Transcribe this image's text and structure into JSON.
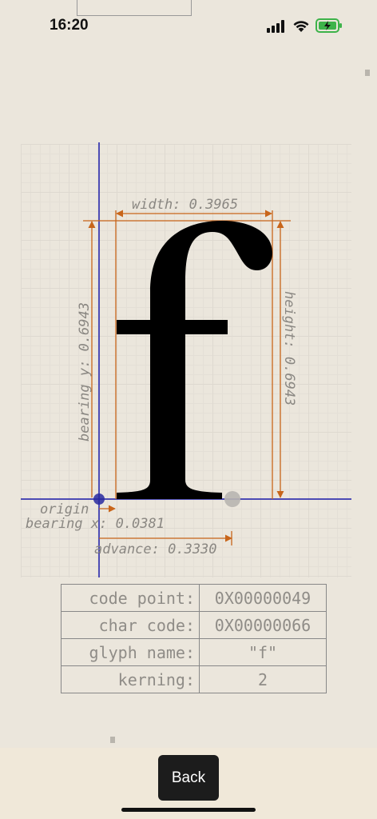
{
  "status_bar": {
    "time": "16:20"
  },
  "glyph": {
    "character": "f",
    "labels": {
      "width": "width: 0.3965",
      "height": "height: 0.6943",
      "bearing_y": "bearing y: 0.6943",
      "origin": "origin",
      "bearing_x": "bearing x: 0.0381",
      "advance": "advance: 0.3330"
    }
  },
  "info_table": [
    {
      "key": "code point:",
      "value": "0X00000049"
    },
    {
      "key": "char code:",
      "value": "0X00000066"
    },
    {
      "key": "glyph name:",
      "value": "\"f\""
    },
    {
      "key": "kerning:",
      "value": "2"
    }
  ],
  "back_button": {
    "label": "Back"
  },
  "colors": {
    "metric_lines": "#c8651a",
    "axis_lines": "#1a1aa8",
    "glyph": "#000000"
  }
}
